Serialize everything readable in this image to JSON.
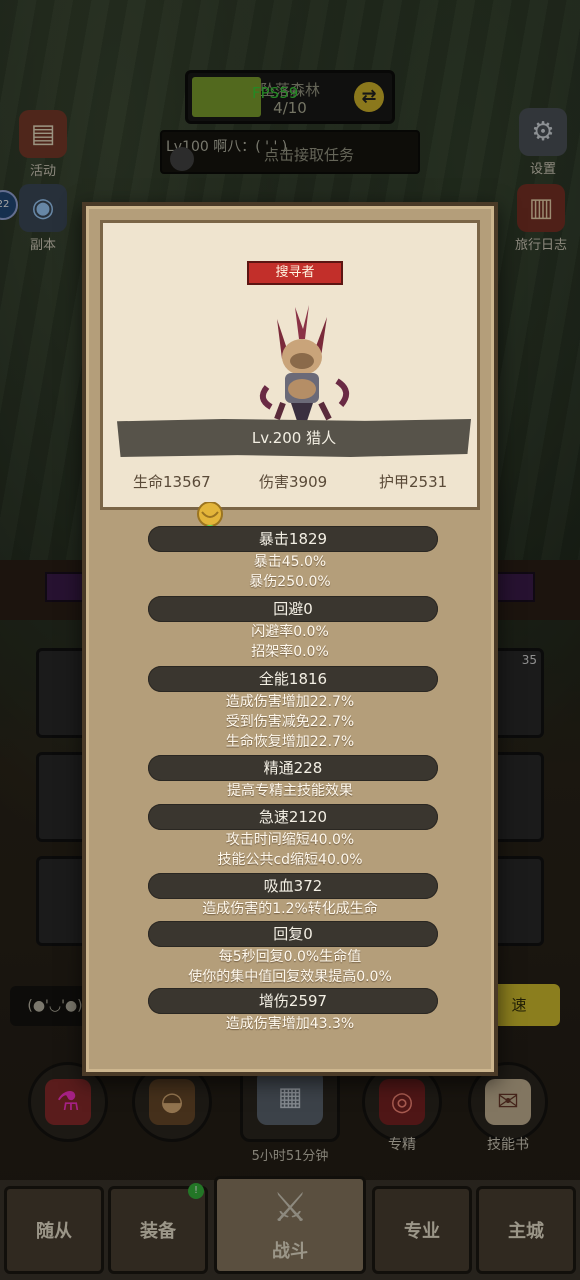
{
  "hud": {
    "zone_title": "坠落森林",
    "progress_count": "4/10",
    "progress_fraction": 0.35,
    "fps": "FPS59",
    "player_line": "Lv100 啊八：(  '  ' )",
    "task_button": "点击接取任务",
    "left_icons": [
      {
        "label": "活动",
        "icon": "activity-board-icon"
      },
      {
        "label": "副本",
        "icon": "dungeon-portal-icon"
      }
    ],
    "right_icons": [
      {
        "label": "设置",
        "icon": "gear-icon"
      },
      {
        "label": "旅行日志",
        "icon": "journal-book-icon"
      }
    ],
    "side_badge": "22",
    "slot_badge": "35",
    "chat_text": "(●'◡'●)",
    "right_button": "速"
  },
  "actions": {
    "timer": "5小时51分钟",
    "items": [
      {
        "label": "",
        "icon": "potion-bag-icon"
      },
      {
        "label": "",
        "icon": "bread-icon"
      },
      {
        "label": "",
        "icon": "treasure-chest-icon"
      },
      {
        "label": "专精",
        "icon": "specialization-icon"
      },
      {
        "label": "技能书",
        "icon": "skill-book-icon"
      }
    ]
  },
  "nav": {
    "tabs": [
      {
        "label": "随从",
        "active": false
      },
      {
        "label": "装备",
        "active": false
      },
      {
        "label": "战斗",
        "active": true
      },
      {
        "label": "专业",
        "active": false
      },
      {
        "label": "主城",
        "active": false
      }
    ],
    "equip_badge": "!"
  },
  "modal": {
    "role_tag": "搜寻者",
    "level_name": "Lv.200 猎人",
    "basic_stats": [
      "生命13567",
      "伤害3909",
      "护甲2531"
    ],
    "sections": [
      {
        "header": "暴击1829",
        "details": [
          "暴击45.0%",
          "暴伤250.0%"
        ]
      },
      {
        "header": "回避0",
        "details": [
          "闪避率0.0%",
          "招架率0.0%"
        ]
      },
      {
        "header": "全能1816",
        "details": [
          "造成伤害增加22.7%",
          "受到伤害减免22.7%",
          "生命恢复增加22.7%"
        ]
      },
      {
        "header": "精通228",
        "details": [
          "提高专精主技能效果"
        ]
      },
      {
        "header": "急速2120",
        "details": [
          "攻击时间缩短40.0%",
          "技能公共cd缩短40.0%"
        ]
      },
      {
        "header": "吸血372",
        "details": [
          "造成伤害的1.2%转化成生命"
        ]
      },
      {
        "header": "回复0",
        "details": [
          "每5秒回复0.0%生命值",
          "使你的集中值回复效果提高0.0%"
        ]
      },
      {
        "header": "增伤2597",
        "details": [
          "造成伤害增加43.3%"
        ]
      }
    ]
  },
  "colors": {
    "header_bg": "#3a362f",
    "role_tag_bg": "#c22f2a",
    "fps_text": "#39d339",
    "progress_fill": "#7fa12f"
  }
}
